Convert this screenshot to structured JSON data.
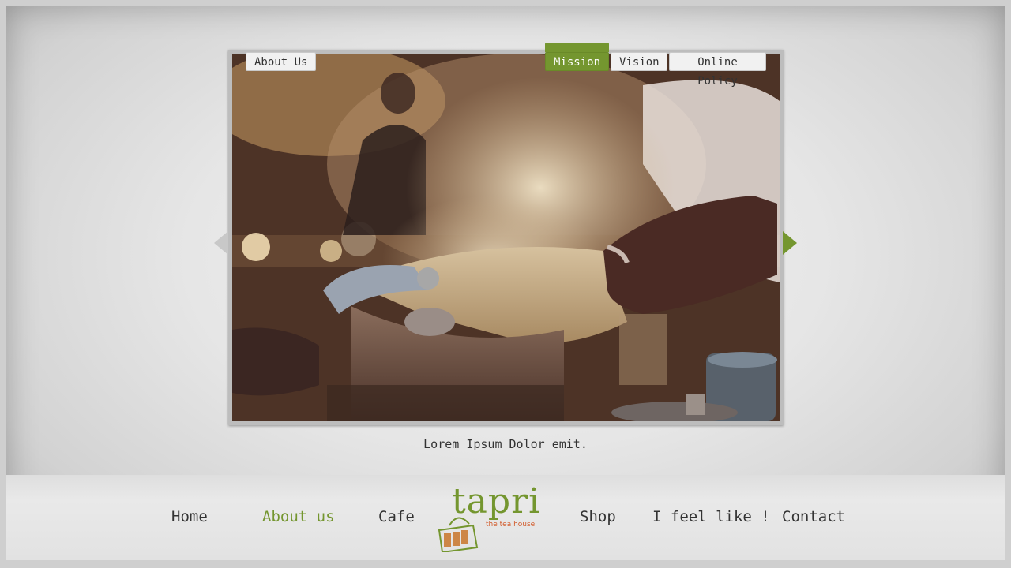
{
  "tabs": [
    {
      "label": "About Us"
    },
    {
      "label": "Mission"
    },
    {
      "label": "Vision"
    },
    {
      "label": "Online Policy"
    }
  ],
  "slider": {
    "caption": "Lorem Ipsum Dolor emit."
  },
  "nav": {
    "items": [
      {
        "label": "Home"
      },
      {
        "label": "About us"
      },
      {
        "label": "Cafe"
      },
      {
        "label": "Shop"
      },
      {
        "label": "I feel like !"
      },
      {
        "label": "Contact"
      }
    ]
  },
  "logo": {
    "name": "tapri",
    "tagline": "the tea house"
  },
  "colors": {
    "accent": "#74962f",
    "logo_tagline": "#d25a2a"
  }
}
